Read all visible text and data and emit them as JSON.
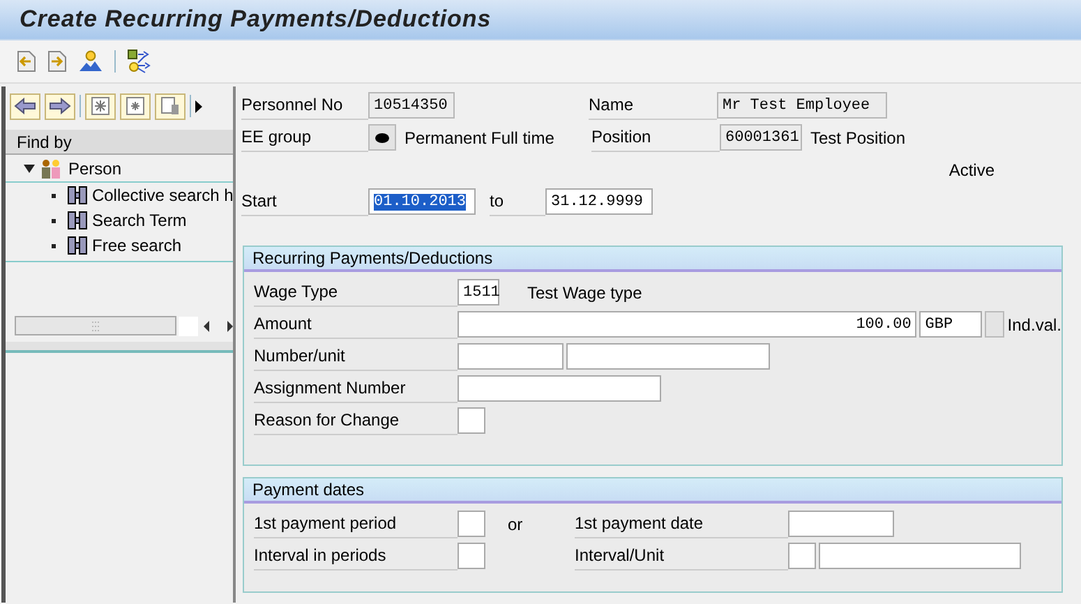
{
  "window": {
    "title": "Create Recurring Payments/Deductions"
  },
  "navigator": {
    "header": "Find by",
    "tree": [
      {
        "label": "Person",
        "expanded": true,
        "children": [
          {
            "label": "Collective search h"
          },
          {
            "label": "Search Term"
          },
          {
            "label": "Free search"
          }
        ]
      }
    ]
  },
  "header": {
    "personnel_no": {
      "label": "Personnel No",
      "value": "10514350"
    },
    "name": {
      "label": "Name",
      "value": "Mr Test Employee"
    },
    "ee_group": {
      "label": "EE group",
      "text": "Permanent Full time"
    },
    "position": {
      "label": "Position",
      "value": "60001361",
      "text": "Test Position"
    },
    "status": "Active",
    "start": {
      "label": "Start",
      "value": "01.10.2013",
      "selected": true
    },
    "to": {
      "label": "to",
      "value": "31.12.9999",
      "selected": false
    }
  },
  "recurring": {
    "title": "Recurring Payments/Deductions",
    "wage_type": {
      "label": "Wage Type",
      "value": "1511",
      "text": "Test Wage type"
    },
    "amount": {
      "label": "Amount",
      "value": "100.00",
      "currency": "GBP",
      "text": "Ind.val."
    },
    "number_unit": {
      "label": "Number/unit"
    },
    "assignment_number": {
      "label": "Assignment Number"
    },
    "reason_for_change": {
      "label": "Reason for Change"
    }
  },
  "payment_dates": {
    "title": "Payment dates",
    "first_period": {
      "label": "1st payment period"
    },
    "or": "or",
    "first_date": {
      "label": "1st payment date"
    },
    "interval_periods": {
      "label": "Interval in periods"
    },
    "interval_unit": {
      "label": "Interval/Unit"
    }
  }
}
